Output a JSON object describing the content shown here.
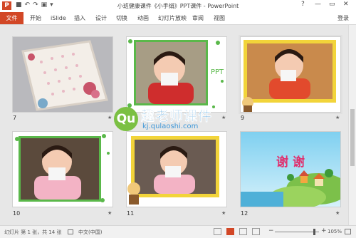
{
  "window": {
    "title": "小班健康课件《小手绢》PPT课件 - PowerPoint",
    "help": "?",
    "minimize": "—",
    "restore": "▭",
    "close": "✕"
  },
  "qat": {
    "save": "■",
    "undo": "↶",
    "redo": "↷",
    "slideshow": "▣",
    "more": "▾"
  },
  "ribbon": {
    "file": "文件",
    "tabs": [
      "开始",
      "iSlide",
      "插入",
      "设计",
      "切换",
      "动画",
      "幻灯片放映",
      "审阅",
      "视图"
    ],
    "login": "登录"
  },
  "slides": [
    {
      "num": "7",
      "star": "★"
    },
    {
      "num": "8",
      "star": "★"
    },
    {
      "num": "9",
      "star": "★"
    },
    {
      "num": "10",
      "star": "★"
    },
    {
      "num": "11",
      "star": "★"
    },
    {
      "num": "12",
      "star": "★",
      "text": "谢 谢"
    }
  ],
  "watermark": {
    "q": "Qu",
    "name": "趣老师课件",
    "url": "kj.qulaoshi.com"
  },
  "status": {
    "slide_info": "幻灯片 第 1 张，共 14 张",
    "lang": "中文(中国)",
    "zoom": "105%",
    "zoom_minus": "−",
    "zoom_plus": "+",
    "zoom_level": 1.05
  },
  "colors": {
    "accent": "#d24726",
    "link": "#3e97d8"
  }
}
